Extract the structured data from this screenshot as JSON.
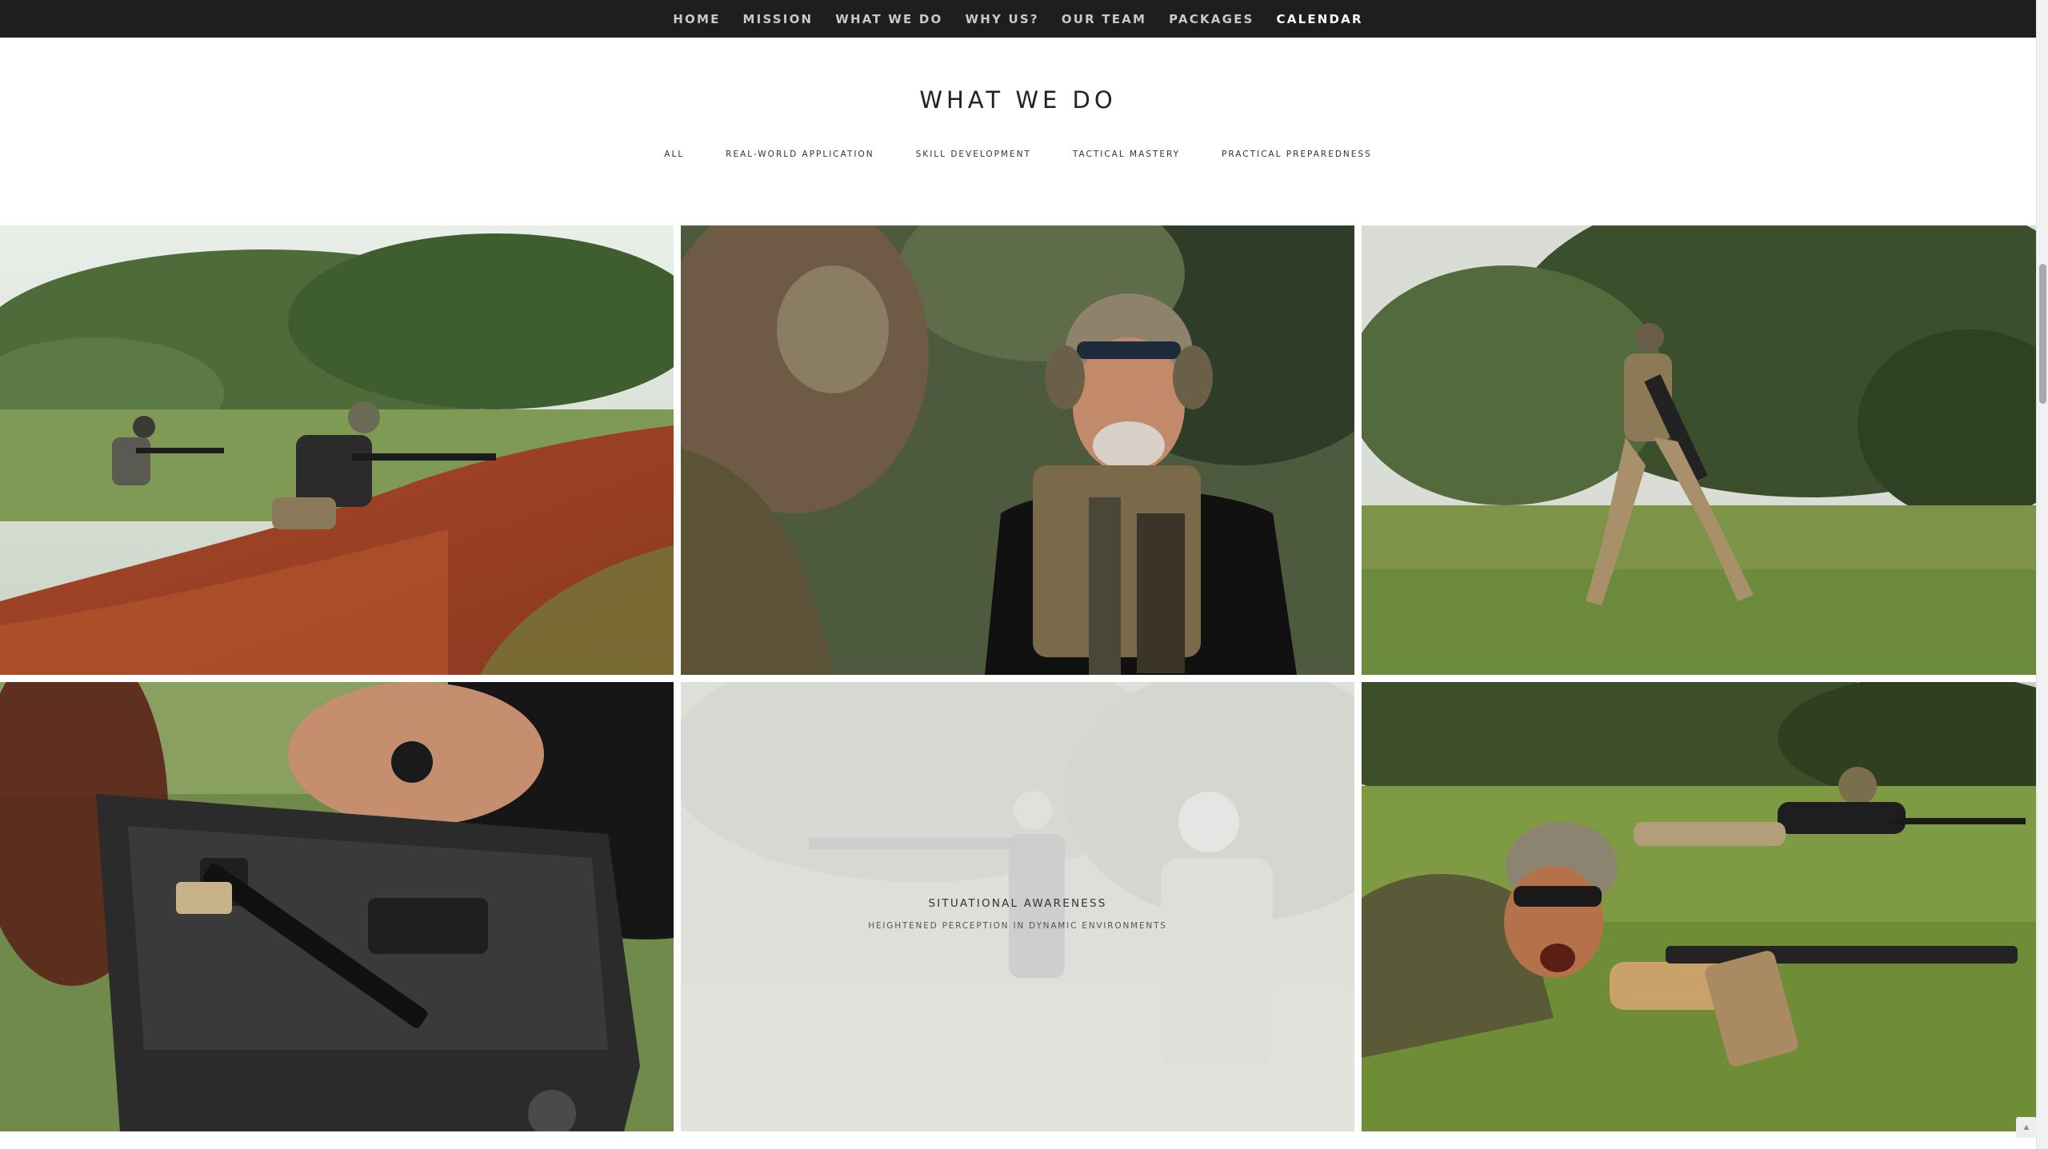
{
  "nav": {
    "items": [
      {
        "label": "HOME"
      },
      {
        "label": "MISSION"
      },
      {
        "label": "WHAT WE DO"
      },
      {
        "label": "WHY US?"
      },
      {
        "label": "OUR TEAM"
      },
      {
        "label": "PACKAGES"
      },
      {
        "label": "CALENDAR",
        "active": true
      }
    ]
  },
  "section": {
    "title": "WHAT WE DO",
    "filters": [
      "ALL",
      "REAL-WORLD APPLICATION",
      "SKILL DEVELOPMENT",
      "TACTICAL MASTERY",
      "PRACTICAL PREPAREDNESS"
    ]
  },
  "gallery": {
    "tiles": [
      {
        "image": "two shooters prone on red dirt hillside with rifles"
      },
      {
        "image": "instructor with camo cap, sunglasses and ear protection holding rifle"
      },
      {
        "image": "shooter moving across grass field with rifle"
      },
      {
        "image": "hands over open hard rifle case with rifle"
      },
      {
        "image": "shooter with rifle among trainees",
        "hover_title": "SITUATIONAL AWARENESS",
        "hover_subtitle": "HEIGHTENED PERCEPTION IN DYNAMIC ENVIRONMENTS"
      },
      {
        "image": "bearded shooter prone in grass shouting with rifle"
      }
    ]
  },
  "colors": {
    "nav_bg": "#1e1e1e",
    "nav_text": "#c9c9c9",
    "nav_active": "#ffffff",
    "page_bg": "#ffffff"
  }
}
